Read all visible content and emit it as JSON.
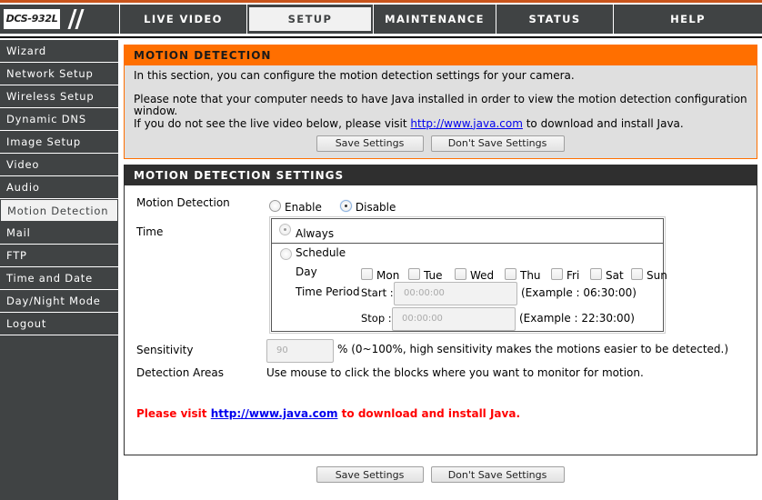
{
  "header": {
    "model": "DCS-932L",
    "tabs": [
      {
        "label": "LIVE VIDEO",
        "active": false
      },
      {
        "label": "SETUP",
        "active": true
      },
      {
        "label": "MAINTENANCE",
        "active": false
      },
      {
        "label": "STATUS",
        "active": false
      },
      {
        "label": "HELP",
        "active": false
      }
    ]
  },
  "sidebar": {
    "items": [
      {
        "label": "Wizard"
      },
      {
        "label": "Network Setup"
      },
      {
        "label": "Wireless Setup"
      },
      {
        "label": "Dynamic DNS"
      },
      {
        "label": "Image Setup"
      },
      {
        "label": "Video"
      },
      {
        "label": "Audio"
      },
      {
        "label": "Motion Detection",
        "active": true
      },
      {
        "label": "Mail"
      },
      {
        "label": "FTP"
      },
      {
        "label": "Time and Date"
      },
      {
        "label": "Day/Night Mode"
      },
      {
        "label": "Logout"
      }
    ]
  },
  "intro": {
    "title": "MOTION DETECTION",
    "line1": "In this section, you can configure the motion detection settings for your camera.",
    "line2": "Please note that your computer needs to have Java installed in order to view the motion detection configuration window.",
    "line3_pre": "If you do not see the live video below, please visit ",
    "line3_link": "http://www.java.com",
    "line3_post": " to download and install Java.",
    "save_label": "Save Settings",
    "nosave_label": "Don't Save Settings"
  },
  "settings": {
    "title": "MOTION DETECTION SETTINGS",
    "motion_label": "Motion Detection",
    "enable_label": "Enable",
    "disable_label": "Disable",
    "motion_value": "Disable",
    "time_label": "Time",
    "always_label": "Always",
    "schedule_label": "Schedule",
    "time_value": "Always",
    "day_label": "Day",
    "days": [
      "Mon",
      "Tue",
      "Wed",
      "Thu",
      "Fri",
      "Sat",
      "Sun"
    ],
    "time_period_label": "Time Period",
    "start_label": "Start :",
    "start_value": "00:00:00",
    "start_example": "(Example : 06:30:00)",
    "stop_label": "Stop :",
    "stop_value": "00:00:00",
    "stop_example": "(Example : 22:30:00)",
    "sensitivity_label": "Sensitivity",
    "sensitivity_value": "90",
    "sensitivity_hint": "%  (0~100%, high sensitivity makes the motions easier to be detected.)",
    "areas_label": "Detection Areas",
    "areas_hint": "Use mouse to click the blocks where you want to monitor for motion.",
    "java_pre": "Please visit ",
    "java_link": "http://www.java.com",
    "java_post": " to download and install Java."
  },
  "footer": {
    "save_label": "Save Settings",
    "nosave_label": "Don't Save Settings"
  },
  "colors": {
    "accent_orange": "#ff6f00",
    "nav_dark": "#404344",
    "header_dark": "#2f2f2f",
    "warning_red": "#ff0000",
    "link_blue": "#0000ee"
  }
}
